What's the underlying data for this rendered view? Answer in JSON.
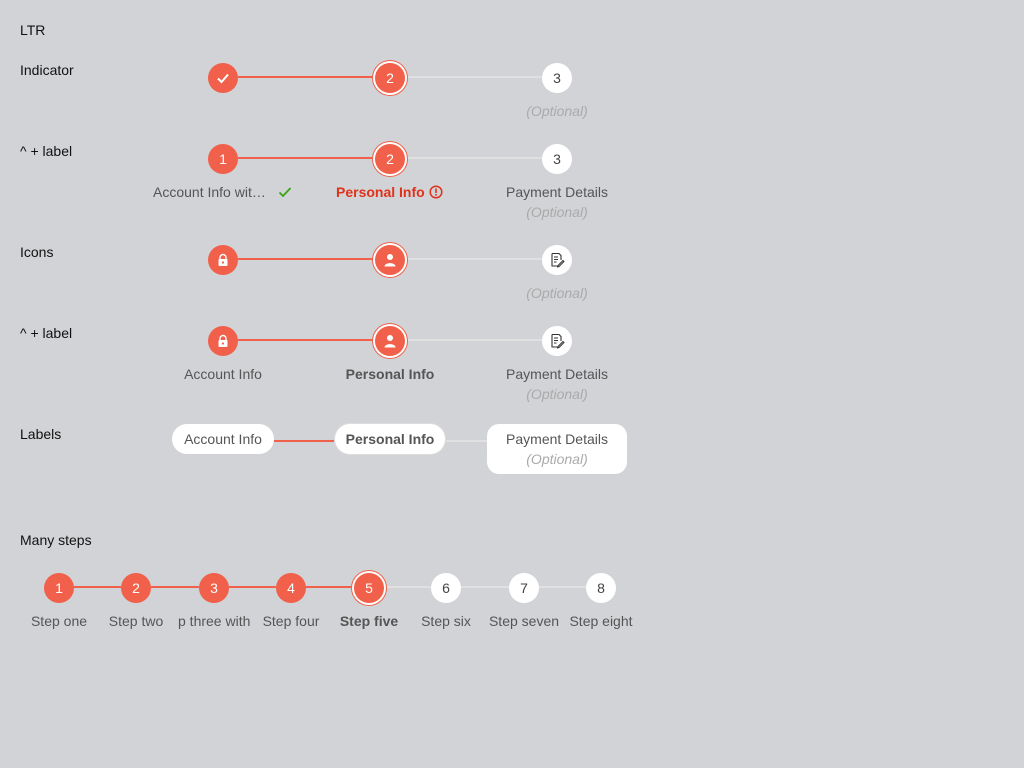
{
  "section_title": "LTR",
  "rows": {
    "indicator": {
      "label": "Indicator",
      "steps": [
        "",
        "2",
        "3"
      ],
      "optional": "(Optional)"
    },
    "indicator_label": {
      "label": "^ + label",
      "steps": [
        "1",
        "2",
        "3"
      ],
      "labels": [
        "Account Info wit…",
        "Personal Info",
        "Payment Details"
      ],
      "optional": "(Optional)"
    },
    "icons": {
      "label": "Icons",
      "icons": [
        "lock-icon",
        "user-icon",
        "edit-icon"
      ],
      "optional": "(Optional)"
    },
    "icons_label": {
      "label": "^ + label",
      "icons": [
        "lock-icon",
        "user-icon",
        "edit-icon"
      ],
      "labels": [
        "Account Info",
        "Personal Info",
        "Payment Details"
      ],
      "optional": "(Optional)"
    },
    "labels": {
      "label": "Labels",
      "labels": [
        "Account Info",
        "Personal Info",
        "Payment Details"
      ],
      "optional": "(Optional)"
    }
  },
  "many_steps": {
    "title": "Many steps",
    "numbers": [
      "1",
      "2",
      "3",
      "4",
      "5",
      "6",
      "7",
      "8"
    ],
    "labels": [
      "Step one",
      "Step two",
      "p three with ¢",
      "Step four",
      "Step five",
      "Step six",
      "Step seven",
      "Step eight"
    ]
  },
  "colors": {
    "accent": "#f0604a",
    "error": "#e0311b",
    "success": "#3aa312",
    "background": "#d1d3d6"
  }
}
